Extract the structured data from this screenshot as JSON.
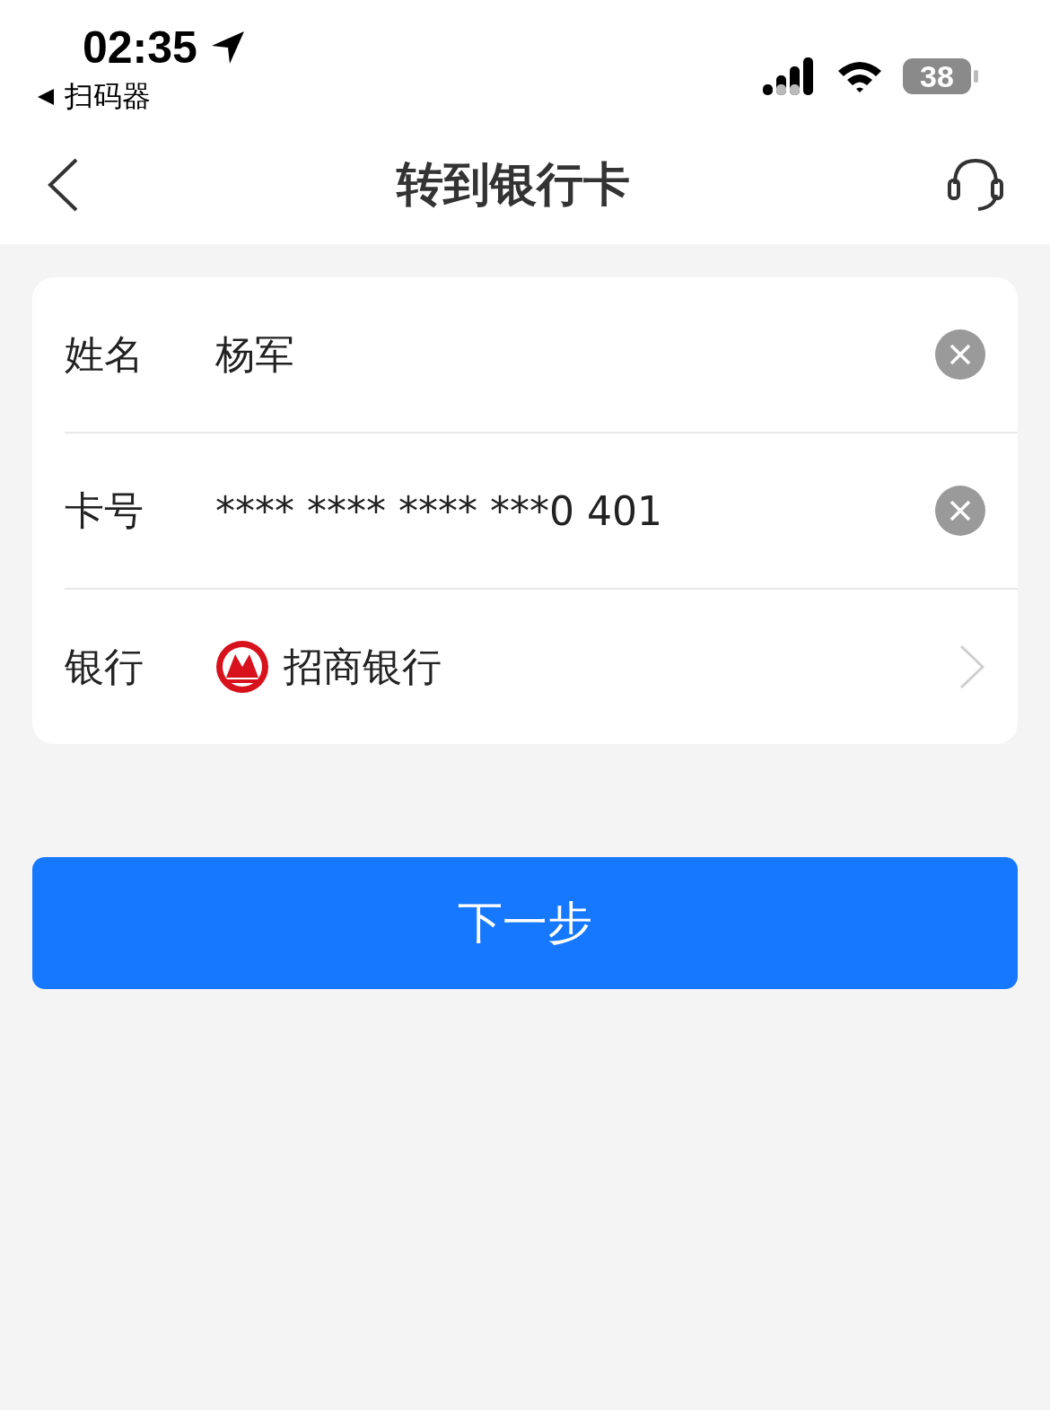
{
  "status_bar": {
    "time": "02:35",
    "back_app": "扫码器",
    "battery": "38"
  },
  "nav_bar": {
    "title": "转到银行卡"
  },
  "form": {
    "rows": [
      {
        "kind": "input",
        "label": "姓名",
        "value": "杨军"
      },
      {
        "kind": "input",
        "label": "卡号",
        "value": "**** **** **** ***0 401"
      },
      {
        "kind": "select",
        "label": "银行",
        "value": "招商银行"
      }
    ]
  },
  "next_button": {
    "label": "下一步"
  }
}
